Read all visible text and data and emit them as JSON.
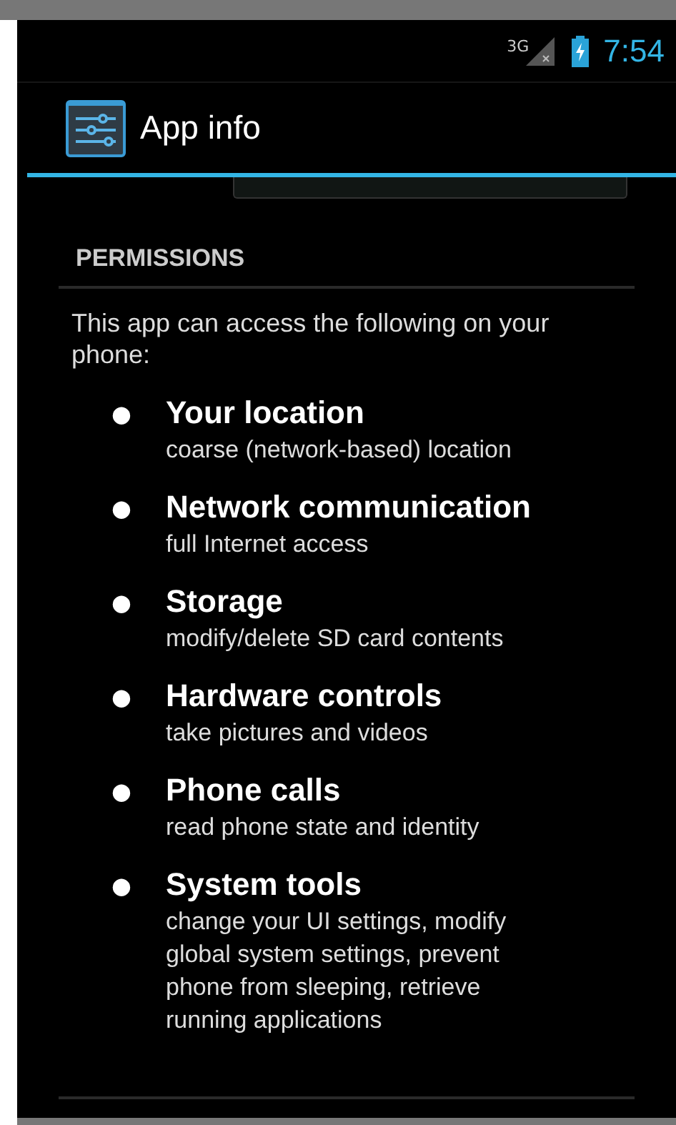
{
  "status_bar": {
    "network": "3G",
    "time": "7:54"
  },
  "action_bar": {
    "title": "App info"
  },
  "section": {
    "header": "PERMISSIONS",
    "intro": "This app can access the following on your phone:"
  },
  "permissions": [
    {
      "bullet": "●",
      "title": "Your location",
      "description": "coarse (network-based) location"
    },
    {
      "bullet": "●",
      "title": "Network communication",
      "description": "full Internet access"
    },
    {
      "bullet": "●",
      "title": "Storage",
      "description": "modify/delete SD card contents"
    },
    {
      "bullet": "●",
      "title": "Hardware controls",
      "description": "take pictures and videos"
    },
    {
      "bullet": "●",
      "title": "Phone calls",
      "description": "read phone state and identity"
    },
    {
      "bullet": "●",
      "title": "System tools",
      "description": "change your UI settings, modify global system settings, prevent phone from sleeping, retrieve running applications"
    }
  ]
}
